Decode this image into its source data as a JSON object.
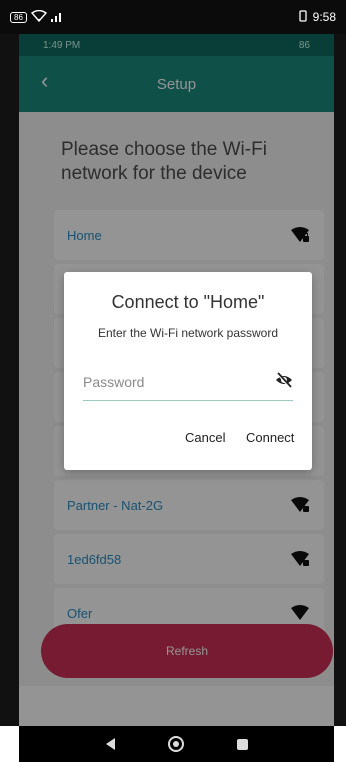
{
  "host_status": {
    "battery": "86",
    "time": "9:58"
  },
  "device_status": {
    "time": "1:49 PM",
    "right_indicator": "86"
  },
  "appbar": {
    "title": "Setup"
  },
  "heading": "Please choose the Wi-Fi network for the device",
  "wifi_list": [
    {
      "name": "Home",
      "icon": "wifi-locked-icon"
    },
    {
      "name": "",
      "icon": ""
    },
    {
      "name": "",
      "icon": ""
    },
    {
      "name": "",
      "icon": ""
    },
    {
      "name": "",
      "icon": ""
    },
    {
      "name": "Partner - Nat-2G",
      "icon": "wifi-locked-icon"
    },
    {
      "name": "1ed6fd58",
      "icon": "wifi-locked-icon"
    },
    {
      "name": "Ofer",
      "icon": "wifi-locked-icon"
    }
  ],
  "dialog": {
    "title": "Connect to \"Home\"",
    "subtitle": "Enter the Wi-Fi network password",
    "password_placeholder": "Password",
    "password_value": "",
    "cancel_label": "Cancel",
    "connect_label": "Connect"
  },
  "refresh_label": "Refresh",
  "colors": {
    "appbar": "#1a8b7d",
    "refresh": "#cc2f55",
    "link": "#2a8fc7"
  }
}
